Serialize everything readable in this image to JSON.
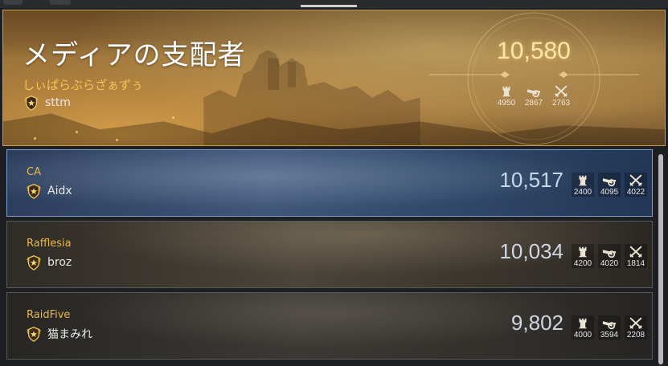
{
  "colors": {
    "accent_gold": "#e8b84a",
    "hero_border": "#c89a4e",
    "highlight_row_border": "#7fa0c8",
    "power_text": "#c8d6ea"
  },
  "top_guild": {
    "title": "メディアの支配者",
    "guild_name": "しぃぱらぶらざぁずぅ",
    "leader": "sttm",
    "power": "10,580",
    "stats": [
      {
        "icon": "castle-tower-icon",
        "value": "4950"
      },
      {
        "icon": "cannon-icon",
        "value": "2867"
      },
      {
        "icon": "crossed-swords-icon",
        "value": "2763"
      }
    ]
  },
  "rows": [
    {
      "guild_name": "CA",
      "leader": "Aidx",
      "power": "10,517",
      "stats": [
        {
          "icon": "castle-tower-icon",
          "value": "2400"
        },
        {
          "icon": "cannon-icon",
          "value": "4095"
        },
        {
          "icon": "crossed-swords-icon",
          "value": "4022"
        }
      ]
    },
    {
      "guild_name": "Rafflesia",
      "leader": "broz",
      "power": "10,034",
      "stats": [
        {
          "icon": "castle-tower-icon",
          "value": "4200"
        },
        {
          "icon": "cannon-icon",
          "value": "4020"
        },
        {
          "icon": "crossed-swords-icon",
          "value": "1814"
        }
      ]
    },
    {
      "guild_name": "RaidFive",
      "leader": "猫まみれ",
      "power": "9,802",
      "stats": [
        {
          "icon": "castle-tower-icon",
          "value": "4000"
        },
        {
          "icon": "cannon-icon",
          "value": "3594"
        },
        {
          "icon": "crossed-swords-icon",
          "value": "2208"
        }
      ]
    }
  ]
}
